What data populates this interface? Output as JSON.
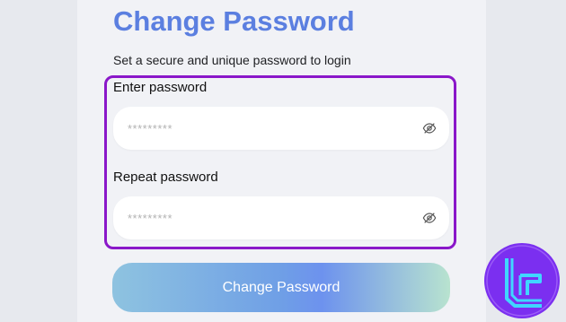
{
  "header": {
    "title": "Change Password",
    "subtitle": "Set a secure and unique password to login"
  },
  "form": {
    "password": {
      "label": "Enter password",
      "placeholder": "*********",
      "value": ""
    },
    "repeat": {
      "label": "Repeat password",
      "placeholder": "*********",
      "value": ""
    },
    "submit_label": "Change Password"
  },
  "icons": {
    "visibility_toggle": "eye-off-icon",
    "brand": "tradingfinder-logo"
  },
  "colors": {
    "title": "#5b7fe0",
    "highlight_border": "#8a17c9",
    "logo_bg": "#7b2ff0",
    "logo_line": "#40d6ff"
  }
}
